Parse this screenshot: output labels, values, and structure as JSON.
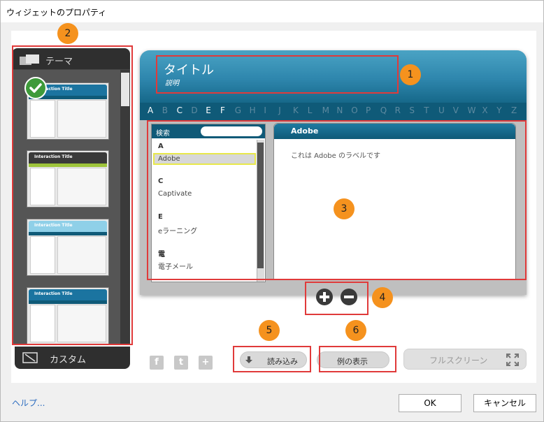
{
  "window": {
    "title": "ウィジェットのプロパティ"
  },
  "theme": {
    "header_label": "テーマ",
    "custom_label": "カスタム",
    "thumbnails": [
      {
        "title": "Interaction Title",
        "header_color": "#1b74a0",
        "bar_color": "#0f5a78",
        "selected": true
      },
      {
        "title": "Interaction Title",
        "header_color": "#3a3a3a",
        "bar_color": "#9ec43a",
        "selected": false
      },
      {
        "title": "Interaction Title",
        "header_color": "#8fd0e8",
        "bar_color": "#0f5a78",
        "selected": false
      },
      {
        "title": "Interaction Title",
        "header_color": "#1b74a0",
        "bar_color": "#0f5a78",
        "selected": false
      }
    ]
  },
  "preview": {
    "title": "タイトル",
    "subtitle": "説明",
    "alphabet": [
      "A",
      "B",
      "C",
      "D",
      "E",
      "F",
      "G",
      "H",
      "I",
      "J",
      "K",
      "L",
      "M",
      "N",
      "O",
      "P",
      "Q",
      "R",
      "S",
      "T",
      "U",
      "V",
      "W",
      "X",
      "Y",
      "Z"
    ],
    "alphabet_active": [
      "A",
      "C",
      "E",
      "F"
    ],
    "search_label": "検索",
    "list": [
      {
        "letter": "A",
        "item": "Adobe"
      },
      {
        "letter": "C",
        "item": "Captivate"
      },
      {
        "letter": "E",
        "item": "eラーニング"
      },
      {
        "letter": "電",
        "item": "電子メール"
      }
    ],
    "selected_item": "Adobe",
    "detail_title": "Adobe",
    "detail_text": "これは Adobe のラベルです"
  },
  "social": [
    {
      "name": "facebook-icon",
      "glyph": "f"
    },
    {
      "name": "twitter-icon",
      "glyph": "t"
    },
    {
      "name": "add-icon",
      "glyph": "+"
    }
  ],
  "buttons": {
    "import_label": "読み込み",
    "example_label": "例の表示",
    "fullscreen_label": "フルスクリーン",
    "ok_label": "OK",
    "cancel_label": "キャンセル",
    "help_label": "ヘルプ..."
  },
  "callouts": [
    "1",
    "2",
    "3",
    "4",
    "5",
    "6"
  ]
}
